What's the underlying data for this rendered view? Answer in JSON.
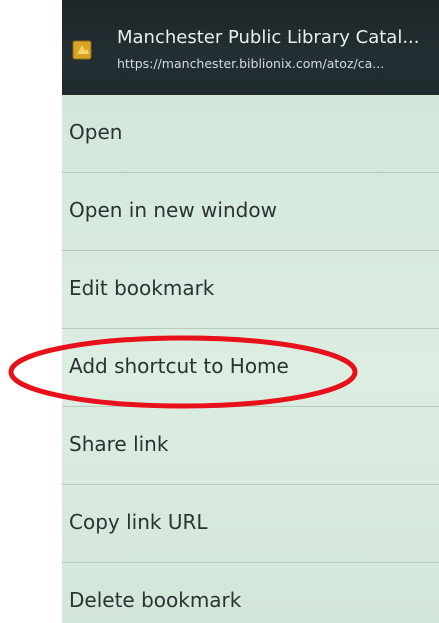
{
  "dialog": {
    "title": "Manchester Public Library Catal...",
    "url": "https://manchester.biblionix.com/atoz/ca...",
    "icon": "bookmark-icon"
  },
  "menu": {
    "items": [
      {
        "label": "Open"
      },
      {
        "label": "Open in new window"
      },
      {
        "label": "Edit bookmark"
      },
      {
        "label": "Add shortcut to Home",
        "highlighted": true
      },
      {
        "label": "Share link"
      },
      {
        "label": "Copy link URL"
      },
      {
        "label": "Delete bookmark"
      }
    ]
  },
  "colors": {
    "header_bg": "#1f2a2d",
    "menu_bg": "#d6e9de",
    "text": "#2a3331",
    "annotation": "#e8101a"
  }
}
